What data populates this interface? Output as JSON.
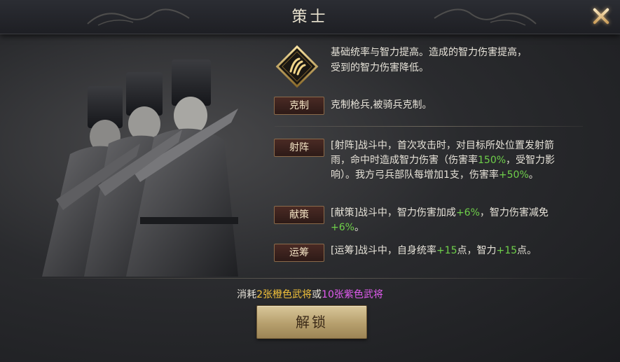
{
  "header": {
    "title": "策士"
  },
  "close_icon": "close-x-icon",
  "emblem_icon": "strategist-claw-icon",
  "description": {
    "line1": "基础统率与智力提高。造成的智力伤害提高，",
    "line2": "受到的智力伤害降低。"
  },
  "counter": {
    "label": "克制",
    "text": "克制枪兵,被骑兵克制。"
  },
  "skills": [
    {
      "label": "射阵",
      "p1": "[射阵]战斗中，首次攻击时，对目标所处位置发射箭雨，命中时造成智力伤害（伤害率",
      "v1": "150%",
      "p2": "，受智力影响）。我方弓兵部队每增加1支，伤害率",
      "v2": "+50%",
      "p3": "。"
    },
    {
      "label": "献策",
      "p1": "[献策]战斗中，智力伤害加成",
      "v1": "+6%",
      "p2": "，智力伤害减免",
      "v2": "+6%",
      "p3": "。"
    },
    {
      "label": "运筹",
      "p1": "[运筹]战斗中，自身统率",
      "v1": "+15",
      "p2": "点，智力",
      "v2": "+15",
      "p3": "点。"
    }
  ],
  "cost": {
    "prefix": "消耗",
    "orange_text": "2张橙色武将",
    "middle": "或",
    "purple_text": "10张紫色武将"
  },
  "unlock_button": {
    "label": "解锁"
  },
  "colors": {
    "value_green": "#6fd04a",
    "orange": "#f3c23a",
    "purple": "#e25cf0",
    "button_gold": "#c9b483"
  }
}
